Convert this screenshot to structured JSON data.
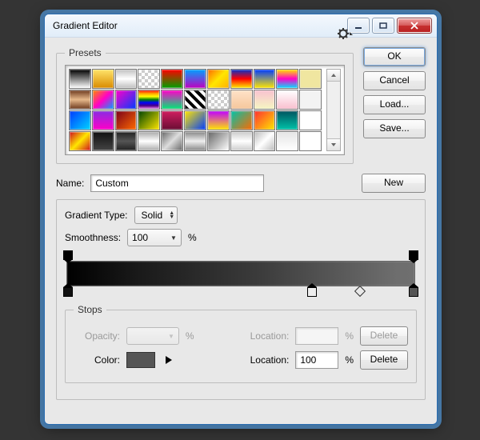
{
  "window": {
    "title": "Gradient Editor"
  },
  "presets": {
    "legend": "Presets",
    "colors": [
      "linear-gradient(#000,#fff)",
      "linear-gradient(#ffe46b,#d98b00)",
      "linear-gradient(#c0c0c0,#fff,#c0c0c0)",
      "repeating-conic-gradient(#ccc 0 25%,#fff 0 50%) 0 0/8px 8px",
      "linear-gradient(#ff0000,#00a000)",
      "linear-gradient(#00a0ff,#c000c0)",
      "linear-gradient(135deg,#ff6a00,#ffe600,#ffb000)",
      "linear-gradient(#0033cc,#ff0000,#ffee00)",
      "linear-gradient(#003cff,#ffe600)",
      "linear-gradient(#ffe600,#ff00c8,#00e0ff)",
      "#f0e6a0",
      "linear-gradient(#6e3b1f,#e7b98b,#6e3b1f)",
      "linear-gradient(135deg,#ff8a00,#ff00c8,#00a0ff)",
      "linear-gradient(135deg,#ff00c8,#003cff)",
      "linear-gradient(red,orange,yellow,green,blue,indigo,violet)",
      "linear-gradient(#ff00c8,#00e676)",
      "repeating-linear-gradient(45deg,#000 0 4px,#fff 4px 8px)",
      "repeating-conic-gradient(#ccc 0 25%,#fff 0 50%) 0 0/8px 8px",
      "linear-gradient(#ffe2c8,#f5c79c)",
      "linear-gradient(#f9c2d0,#f5f5c2)",
      "linear-gradient(#fff,#f9bfcf)",
      "#f3f3f3",
      "linear-gradient(135deg,#003cff,#00d4ff)",
      "linear-gradient(#8a2be2,#ff00c8)",
      "linear-gradient(135deg,#7a0019,#ff6a00)",
      "linear-gradient(135deg,#004400,#ffe600)",
      "linear-gradient(#cf1e5f,#6a0d34)",
      "linear-gradient(135deg,#ffe600,#003cff)",
      "linear-gradient(#c000ff,#ffe600)",
      "linear-gradient(135deg,#00c2a8,#ff6a00)",
      "linear-gradient(135deg,#ff3030,#ffe600)",
      "linear-gradient(#005560,#00c2a8)",
      "#ffffff",
      "linear-gradient(135deg,#cf1020,#ffe600,#cf1020)",
      "linear-gradient(#111,#444)",
      "linear-gradient(#222,#555,#222)",
      "linear-gradient(#aaa,#fff,#aaa)",
      "linear-gradient(135deg,#666,#ddd,#666)",
      "linear-gradient(#888,#eee,#888)",
      "linear-gradient(135deg,#666,#fff)",
      "linear-gradient(#ccc,#fff,#ccc)",
      "linear-gradient(135deg,#bbb,#fff,#bbb)",
      "linear-gradient(#e5e5e5,#fff)",
      "#ffffff"
    ]
  },
  "buttons": {
    "ok": "OK",
    "cancel": "Cancel",
    "load": "Load...",
    "save": "Save...",
    "new": "New",
    "delete": "Delete"
  },
  "name": {
    "label": "Name:",
    "value": "Custom"
  },
  "type": {
    "label": "Gradient Type:",
    "value": "Solid"
  },
  "smoothness": {
    "label": "Smoothness:",
    "value": "100",
    "unit": "%"
  },
  "stops": {
    "legend": "Stops",
    "opacity_label": "Opacity:",
    "opacity_unit": "%",
    "location_label": "Location:",
    "location_unit": "%",
    "color_label": "Color:",
    "location_value": "100"
  }
}
